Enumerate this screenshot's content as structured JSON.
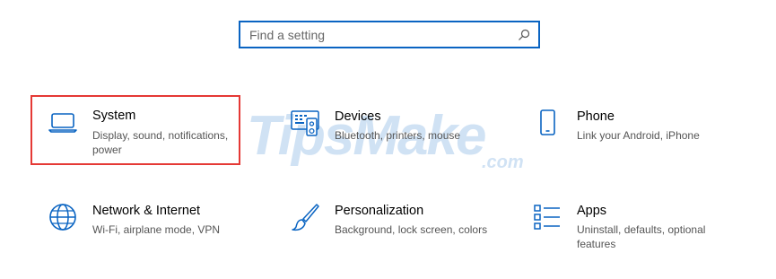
{
  "search": {
    "placeholder": "Find a setting",
    "icon": "search-icon"
  },
  "watermark": {
    "text": "TipsMake",
    "suffix": ".com"
  },
  "accent": "#0a64c2",
  "highlight": "#e53935",
  "tiles": [
    {
      "key": "system",
      "title": "System",
      "description": "Display, sound, notifications, power",
      "icon": "laptop-icon"
    },
    {
      "key": "devices",
      "title": "Devices",
      "description": "Bluetooth, printers, mouse",
      "icon": "keyboard-speaker-icon"
    },
    {
      "key": "phone",
      "title": "Phone",
      "description": "Link your Android, iPhone",
      "icon": "phone-icon"
    },
    {
      "key": "network",
      "title": "Network & Internet",
      "description": "Wi-Fi, airplane mode, VPN",
      "icon": "globe-icon"
    },
    {
      "key": "personalization",
      "title": "Personalization",
      "description": "Background, lock screen, colors",
      "icon": "paintbrush-icon"
    },
    {
      "key": "apps",
      "title": "Apps",
      "description": "Uninstall, defaults, optional features",
      "icon": "apps-list-icon"
    }
  ]
}
